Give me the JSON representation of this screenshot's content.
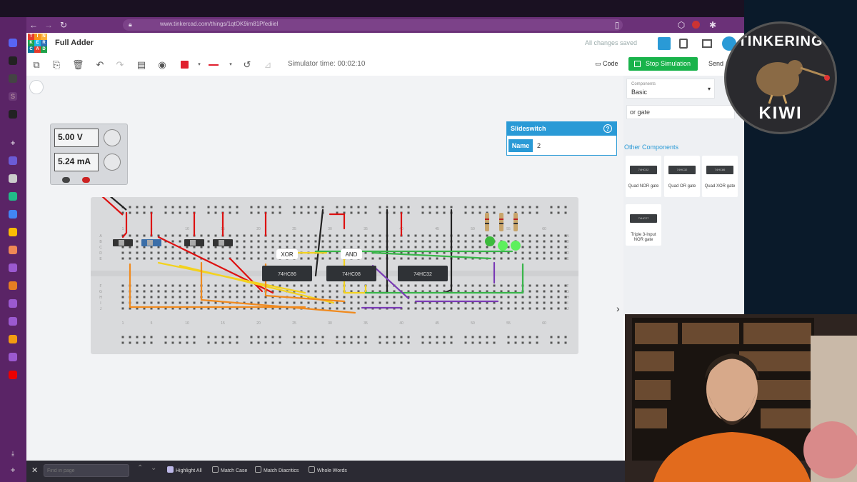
{
  "browser": {
    "url": "www.tinkercad.com/things/1qtOK9im81Pfediiel"
  },
  "app": {
    "logo_letters": [
      "T",
      "I",
      "N",
      "K",
      "E",
      "R",
      "C",
      "A",
      "D"
    ],
    "title": "Full Adder",
    "save_status": "All changes saved",
    "simulator_time": "Simulator time: 00:02:10",
    "code_label": "Code",
    "stop_label": "Stop Simulation",
    "send_label": "Send"
  },
  "power_supply": {
    "voltage": "5.00 V",
    "current": "5.24 mA"
  },
  "breadboard": {
    "row_labels": [
      "A",
      "B",
      "C",
      "D",
      "E",
      "F",
      "G",
      "H",
      "I",
      "J"
    ],
    "column_numbers": [
      "1",
      "5",
      "10",
      "15",
      "20",
      "25",
      "30",
      "35",
      "40",
      "45",
      "50",
      "55",
      "60"
    ],
    "chips": [
      "74HC86",
      "74HC08",
      "74HC32"
    ],
    "chip_labels": [
      "XOR",
      "AND"
    ]
  },
  "inspector": {
    "title": "Slideswitch",
    "name_label": "Name",
    "name_value": "2"
  },
  "components_panel": {
    "category_caption": "Components",
    "category_value": "Basic",
    "search_value": "or gate",
    "other_title": "Other Components",
    "items": [
      {
        "chip": "74HC02",
        "label": "Quad NOR gate"
      },
      {
        "chip": "74HC32",
        "label": "Quad OR gate"
      },
      {
        "chip": "74HC86",
        "label": "Quad XOR gate"
      },
      {
        "chip": "74HC27",
        "label": "Triple 3-Input NOR gate"
      }
    ]
  },
  "find_bar": {
    "placeholder": "Find in page",
    "options": [
      {
        "label": "Highlight All",
        "checked": true
      },
      {
        "label": "Match Case",
        "checked": false
      },
      {
        "label": "Match Diacritics",
        "checked": false
      },
      {
        "label": "Whole Words",
        "checked": false
      }
    ]
  },
  "overlay": {
    "badge_top": "TINKERING",
    "badge_bottom": "KIWI"
  },
  "colors": {
    "accent": "#2a9ad6",
    "stop_green": "#19b34b",
    "browser_purple": "#6b3178"
  }
}
